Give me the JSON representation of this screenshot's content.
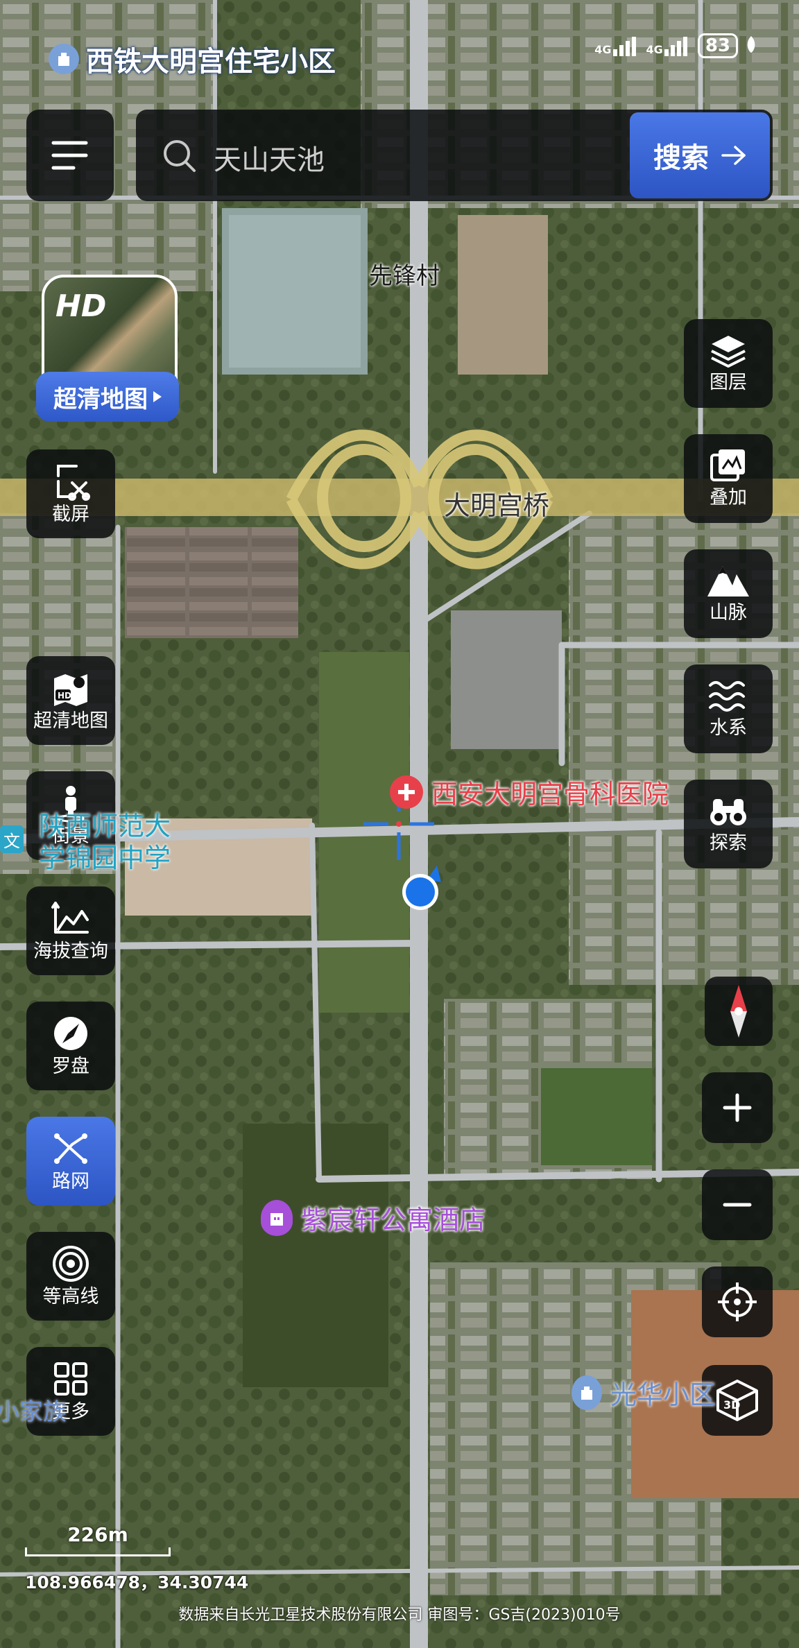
{
  "status_bar": {
    "location_name": "西铁大明宫住宅小区",
    "signal1": "4G",
    "signal2": "4G",
    "battery": "83"
  },
  "search": {
    "placeholder": "天山天池",
    "button_label": "搜索"
  },
  "hd_badge": {
    "hd_text": "HD",
    "label": "超清地图"
  },
  "left_tools": [
    {
      "label": "截屏",
      "icon": "screenshot-icon"
    },
    {
      "label": "超清地图",
      "icon": "hd-map-icon"
    },
    {
      "label": "街景",
      "icon": "street-view-icon"
    },
    {
      "label": "海拔查询",
      "icon": "elevation-icon"
    },
    {
      "label": "罗盘",
      "icon": "compass-icon"
    },
    {
      "label": "路网",
      "icon": "road-network-icon",
      "active": true
    },
    {
      "label": "等高线",
      "icon": "contour-icon"
    },
    {
      "label": "更多",
      "icon": "more-icon"
    }
  ],
  "right_tools": [
    {
      "label": "图层",
      "icon": "layers-icon"
    },
    {
      "label": "叠加",
      "icon": "overlay-icon"
    },
    {
      "label": "山脉",
      "icon": "mountain-icon"
    },
    {
      "label": "水系",
      "icon": "water-icon"
    },
    {
      "label": "探索",
      "icon": "binoculars-icon"
    }
  ],
  "map_labels": {
    "village": "先锋村",
    "bridge": "大明宫桥",
    "hospital": "西安大明宫骨科医院",
    "school_line1": "陕西师范大",
    "school_line2": "学锦园中学",
    "hotel": "紫宸轩公寓酒店",
    "community": "光华小区",
    "partial_left": "小家族",
    "wen_badge": "文"
  },
  "scale": {
    "distance": "226m",
    "coordinates": "108.966478，34.30744"
  },
  "attribution": "数据来自长光卫星技术股份有限公司 审图号：GS吉(2023)010号",
  "colors": {
    "accent_blue": "#3a63d6",
    "hospital_red": "#e8404a",
    "hotel_purple": "#a64fd8",
    "location_blue": "#1a73e8"
  }
}
